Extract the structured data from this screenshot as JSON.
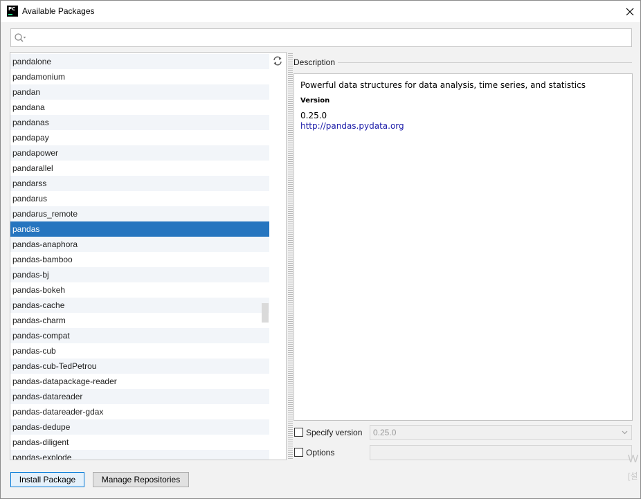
{
  "window": {
    "app_icon_text": "PC",
    "title": "Available Packages"
  },
  "search": {
    "value": "",
    "placeholder": ""
  },
  "packages": [
    "pandalone",
    "pandamonium",
    "pandan",
    "pandana",
    "pandanas",
    "pandapay",
    "pandapower",
    "pandarallel",
    "pandarss",
    "pandarus",
    "pandarus_remote",
    "pandas",
    "pandas-anaphora",
    "pandas-bamboo",
    "pandas-bj",
    "pandas-bokeh",
    "pandas-cache",
    "pandas-charm",
    "pandas-compat",
    "pandas-cub",
    "pandas-cub-TedPetrou",
    "pandas-datapackage-reader",
    "pandas-datareader",
    "pandas-datareader-gdax",
    "pandas-dedupe",
    "pandas-diligent",
    "pandas-explode"
  ],
  "selected_package": "pandas",
  "description": {
    "label": "Description",
    "summary": "Powerful data structures for data analysis, time series, and statistics",
    "version_label": "Version",
    "version": "0.25.0",
    "url": "http://pandas.pydata.org"
  },
  "options": {
    "specify_version_label": "Specify version",
    "specify_version_checked": false,
    "version_value": "0.25.0",
    "options_label": "Options",
    "options_checked": false,
    "options_value": ""
  },
  "buttons": {
    "install": "Install Package",
    "manage": "Manage Repositories"
  },
  "watermark": {
    "line1": "W",
    "line2": "[설"
  },
  "colors": {
    "selection": "#2675bf",
    "alt_row": "#f2f5f9",
    "link": "#1a1aa8",
    "focus_border": "#0078d7"
  },
  "icons": {
    "app": "pycharm-icon",
    "close": "close-icon",
    "search": "search-icon",
    "refresh": "refresh-icon",
    "dropdown": "chevron-down-icon"
  }
}
